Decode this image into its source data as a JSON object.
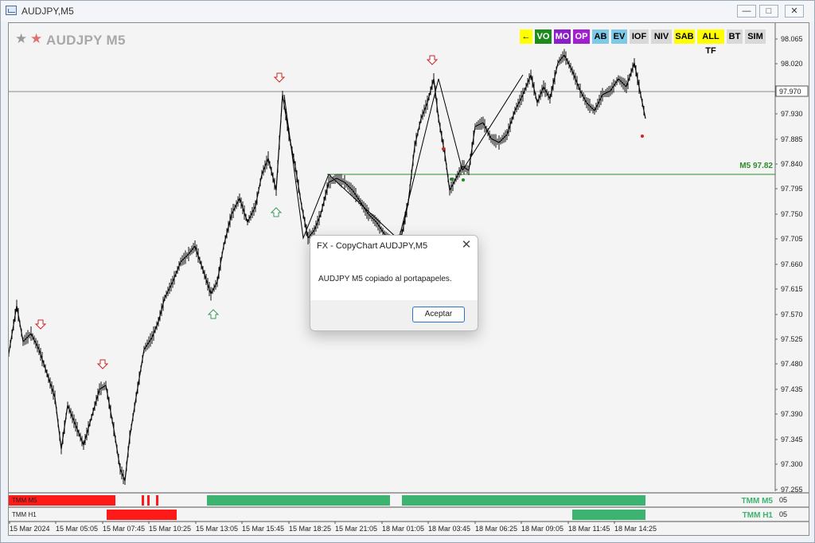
{
  "window": {
    "title": "AUDJPY,M5",
    "min_glyph": "—",
    "max_glyph": "□",
    "close_glyph": "✕"
  },
  "chart": {
    "symbol": "AUDJPY M5",
    "price_level_label": "M5 97.82",
    "current_price": "97.970",
    "y_ticks": [
      "98.065",
      "98.020",
      "97.970",
      "97.930",
      "97.885",
      "97.840",
      "97.795",
      "97.750",
      "97.705",
      "97.660",
      "97.615",
      "97.570",
      "97.525",
      "97.480",
      "97.435",
      "97.390",
      "97.345",
      "97.300",
      "97.255"
    ],
    "x_ticks": [
      "15 Mar 2024",
      "15 Mar 05:05",
      "15 Mar 07:45",
      "15 Mar 10:25",
      "15 Mar 13:05",
      "15 Mar 15:45",
      "15 Mar 18:25",
      "15 Mar 21:05",
      "18 Mar 01:05",
      "18 Mar 03:45",
      "18 Mar 06:25",
      "18 Mar 09:05",
      "18 Mar 11:45",
      "18 Mar 14:25"
    ],
    "sub_tmm_m5_label": "TMM M5",
    "sub_tmm_m5_tag": "TMM M5",
    "sub_tmm_m5_value": "05",
    "sub_tmm_h1_label": "TMM H1",
    "sub_tmm_h1_tag": "TMM H1",
    "sub_tmm_h1_value": "05",
    "colors": {
      "up_arrow": "#3a9a55",
      "down_arrow": "#cc2222",
      "bull_bar": "#3cb371",
      "bear_bar": "#ff1a1a",
      "level_line": "#2e8b2e"
    }
  },
  "toolbar": [
    {
      "label": "←",
      "bg": "#ffff00",
      "fg": "#000000"
    },
    {
      "label": "VO",
      "bg": "#1e8a1e",
      "fg": "#ffffff"
    },
    {
      "label": "MO",
      "bg": "#8a1ec8",
      "fg": "#ffffff"
    },
    {
      "label": "OP",
      "bg": "#a020d0",
      "fg": "#ffffff"
    },
    {
      "label": "AB",
      "bg": "#7ec8e8",
      "fg": "#000000"
    },
    {
      "label": "EV",
      "bg": "#7ec8e8",
      "fg": "#000000"
    },
    {
      "label": "IOF",
      "bg": "#d8d8d8",
      "fg": "#000000"
    },
    {
      "label": "NIV",
      "bg": "#d8d8d8",
      "fg": "#000000"
    },
    {
      "label": "SAB",
      "bg": "#ffff00",
      "fg": "#000000"
    },
    {
      "label": "ALL TF",
      "bg": "#ffff00",
      "fg": "#000000"
    },
    {
      "label": "BT",
      "bg": "#d8d8d8",
      "fg": "#000000"
    },
    {
      "label": "SIM",
      "bg": "#d8d8d8",
      "fg": "#000000"
    }
  ],
  "dialog": {
    "title": "FX - CopyChart AUDJPY,M5",
    "message": "AUDJPY M5 copiado al portapapeles.",
    "ok_label": "Aceptar",
    "close_glyph": "✕"
  }
}
